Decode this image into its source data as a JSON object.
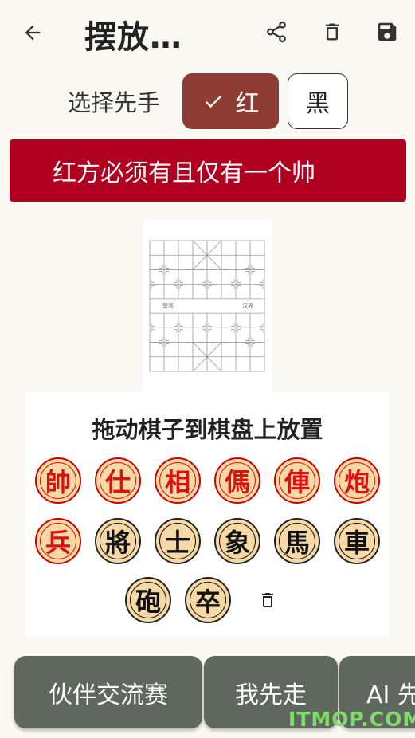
{
  "header": {
    "title": "摆放…"
  },
  "first_move": {
    "label": "选择先手",
    "options": [
      {
        "label": "红",
        "selected": true
      },
      {
        "label": "黑",
        "selected": false
      }
    ]
  },
  "error_message": "红方必须有且仅有一个帅",
  "board": {
    "river_left": "楚河",
    "river_right": "汉界"
  },
  "palette": {
    "title": "拖动棋子到棋盘上放置",
    "pieces": [
      {
        "char": "帥",
        "side": "red"
      },
      {
        "char": "仕",
        "side": "red"
      },
      {
        "char": "相",
        "side": "red"
      },
      {
        "char": "傌",
        "side": "red"
      },
      {
        "char": "俥",
        "side": "red"
      },
      {
        "char": "炮",
        "side": "red"
      },
      {
        "char": "兵",
        "side": "red"
      },
      {
        "char": "將",
        "side": "black"
      },
      {
        "char": "士",
        "side": "black"
      },
      {
        "char": "象",
        "side": "black"
      },
      {
        "char": "馬",
        "side": "black"
      },
      {
        "char": "車",
        "side": "black"
      },
      {
        "char": "砲",
        "side": "black"
      },
      {
        "char": "卒",
        "side": "black"
      }
    ]
  },
  "bottom_buttons": [
    {
      "label": "伙伴交流赛"
    },
    {
      "label": "我先走"
    },
    {
      "label": "AI 先"
    }
  ],
  "watermark": "ITMOP.COM",
  "colors": {
    "selected_option": "#8d3b33",
    "error": "#b00020",
    "button": "#5f675f"
  }
}
